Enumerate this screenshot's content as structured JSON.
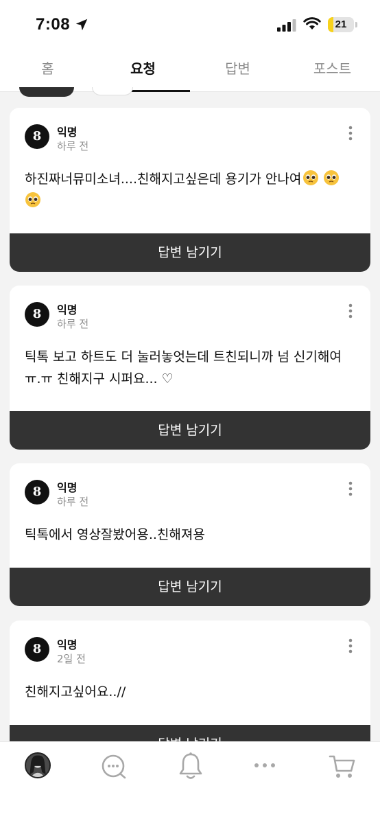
{
  "status_bar": {
    "time": "7:08",
    "battery_level": "21",
    "battery_fraction": 0.21,
    "icons": [
      "location-arrow-icon",
      "cellular-signal-icon",
      "wifi-icon",
      "battery-icon"
    ]
  },
  "tabs": [
    {
      "label": "홈",
      "active": false
    },
    {
      "label": "요청",
      "active": true
    },
    {
      "label": "답변",
      "active": false
    },
    {
      "label": "포스트",
      "active": false
    }
  ],
  "cards": [
    {
      "author": "익명",
      "time": "하루 전",
      "text": "하진짜너뮤미소녀....친해지고싶은데 용기가 안나여",
      "emoji_count": 3,
      "reply_label": "답변 남기기"
    },
    {
      "author": "익명",
      "time": "하루 전",
      "text": "틱톡 보고 하트도 더 눌러놓엇는데 트친되니까 넘 신기해여 ㅠ.ㅠ 친해지구 시퍼요... ♡",
      "reply_label": "답변 남기기"
    },
    {
      "author": "익명",
      "time": "하루 전",
      "text": "틱톡에서 영상잘봤어용..친해져용",
      "reply_label": "답변 남기기"
    },
    {
      "author": "익명",
      "time": "2일 전",
      "text": "친해지고싶어요..//",
      "reply_label": "답변 남기기"
    }
  ],
  "avatar_glyph": "8",
  "bottom_nav": [
    {
      "name": "profile-avatar",
      "icon": "avatar-icon"
    },
    {
      "name": "chat",
      "icon": "chat-bubble-icon"
    },
    {
      "name": "notifications",
      "icon": "bell-icon"
    },
    {
      "name": "more",
      "icon": "ellipsis-icon"
    },
    {
      "name": "shop",
      "icon": "cart-icon"
    }
  ],
  "colors": {
    "background": "#f3f3f3",
    "card": "#ffffff",
    "button": "#333333",
    "battery": "#f7d21c",
    "muted": "#8e8e8e"
  }
}
